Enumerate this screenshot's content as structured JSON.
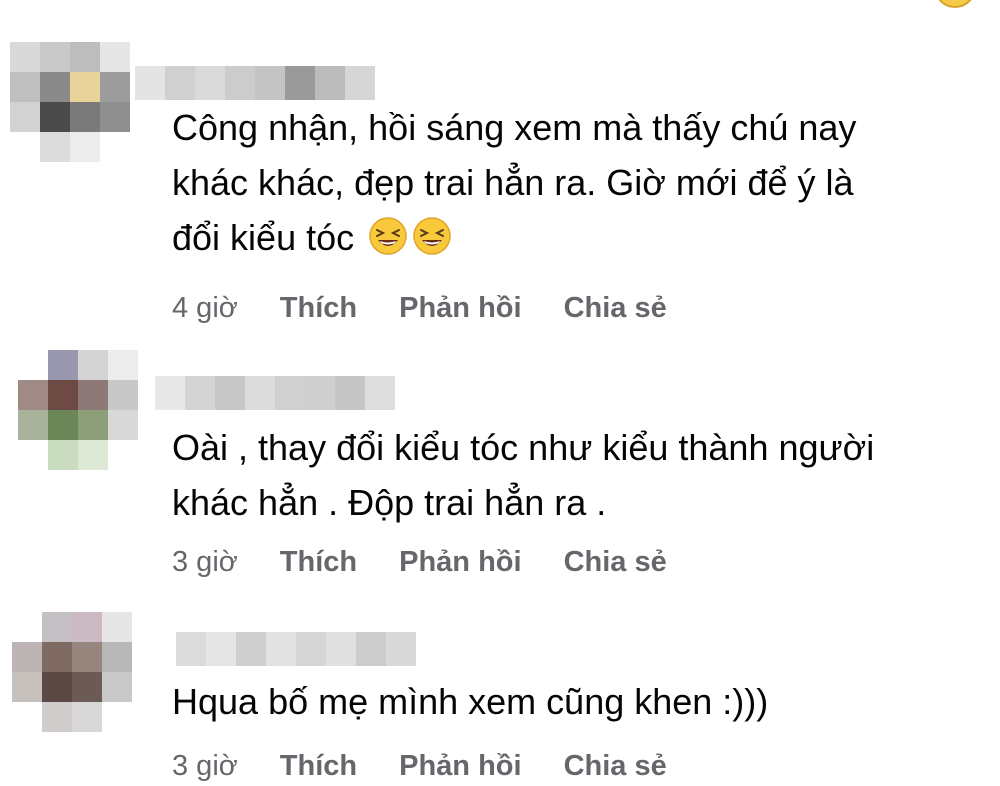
{
  "comments": [
    {
      "text_lines": [
        "Công nhận, hồi sáng xem mà thấy chú nay",
        "khác khác, đẹp trai hẳn ra. Giờ mới để ý là",
        "đổi kiểu tóc"
      ],
      "emojis": [
        "grinning-squinting-face-emoji",
        "grinning-squinting-face-emoji"
      ],
      "time": "4 giờ",
      "like": "Thích",
      "reply": "Phản hồi",
      "share": "Chia sẻ"
    },
    {
      "text_lines": [
        "Oài , thay đổi kiểu tóc như kiểu thành người",
        "khác hẳn . Độp trai hẳn ra ."
      ],
      "time": "3 giờ",
      "like": "Thích",
      "reply": "Phản hồi",
      "share": "Chia sẻ"
    },
    {
      "text_lines": [
        "Hqua bố mẹ mình xem cũng khen :)))"
      ],
      "time": "3 giờ",
      "like": "Thích",
      "reply": "Phản hồi",
      "share": "Chia sẻ"
    }
  ],
  "colors": {
    "bubble": "#f0f2f5",
    "text": "#050505",
    "meta": "#65676b"
  }
}
